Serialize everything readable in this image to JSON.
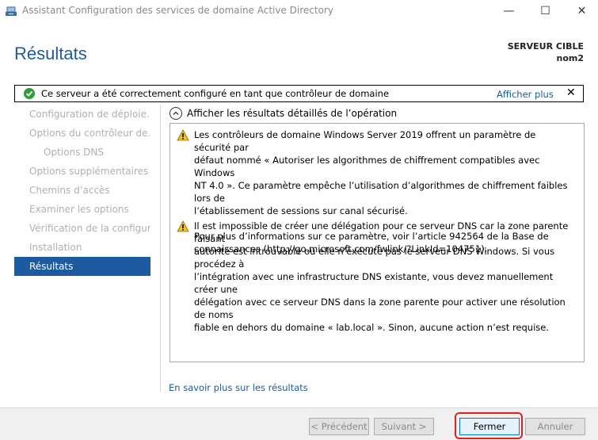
{
  "window": {
    "title": "Assistant Configuration des services de domaine Active Directory",
    "minimize": "—",
    "maximize": "☐",
    "close": "✕"
  },
  "header": {
    "title": "Résultats",
    "target_label": "SERVEUR CIBLE",
    "target_name": "nom2"
  },
  "notification": {
    "message": "Ce serveur a été correctement configuré en tant que contrôleur de domaine",
    "more_link": "Afficher plus",
    "dismiss": "✕",
    "status_color": "#2e9e3a"
  },
  "nav": {
    "items": [
      {
        "label": "Configuration de déploie..."
      },
      {
        "label": "Options du contrôleur de..."
      },
      {
        "label": "Options DNS"
      },
      {
        "label": "Options supplémentaires"
      },
      {
        "label": "Chemins d’accès"
      },
      {
        "label": "Examiner les options"
      },
      {
        "label": "Vérification de la configur..."
      },
      {
        "label": "Installation"
      },
      {
        "label": "Résultats"
      }
    ],
    "active_color": "#1e5aa0"
  },
  "details": {
    "toggle_label": "Afficher les résultats détaillés de l’opération",
    "warnings": [
      {
        "lines": [
          "Les contrôleurs de domaine Windows Server 2019 offrent un paramètre de sécurité par",
          "défaut nommé « Autoriser les algorithmes de chiffrement compatibles avec Windows",
          "NT 4.0 ». Ce paramètre empêche l’utilisation d’algorithmes de chiffrement faibles lors de",
          "l’établissement de sessions sur canal sécurisé.",
          "",
          "Pour plus d’informations sur ce paramètre, voir l’article 942564 de la Base de",
          "connaissances (http://go.microsoft.com/fwlink/?LinkId=104751)."
        ]
      },
      {
        "lines": [
          "Il est impossible de créer une délégation pour ce serveur DNS car la zone parente faisant",
          "autorité est introuvable ou elle n’exécute pas le serveur DNS Windows. Si vous procédez à",
          "l’intégration avec une infrastructure DNS existante, vous devez manuellement créer une",
          "délégation avec ce serveur DNS dans la zone parente pour activer une résolution de noms",
          "fiable en dehors du domaine « lab.local ». Sinon, aucune action n’est requise."
        ]
      }
    ],
    "learn_more": "En savoir plus sur les résultats"
  },
  "footer": {
    "prev": "< Précédent",
    "next": "Suivant >",
    "close": "Fermer",
    "cancel": "Annuler",
    "highlight_color": "#e02020"
  }
}
